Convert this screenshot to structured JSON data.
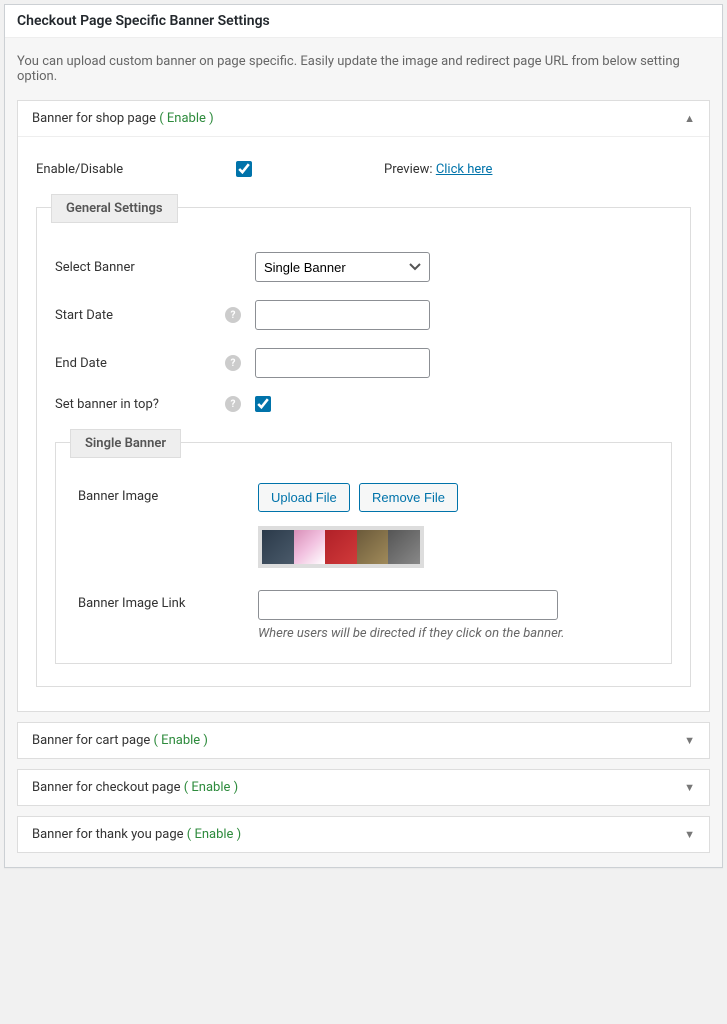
{
  "header": {
    "title": "Checkout Page Specific Banner Settings"
  },
  "description": "You can upload custom banner on page specific. Easily update the image and redirect page URL from below setting option.",
  "accordions": [
    {
      "title": "Banner for shop page",
      "status": "( Enable )",
      "expanded": true
    },
    {
      "title": "Banner for cart page",
      "status": "( Enable )",
      "expanded": false
    },
    {
      "title": "Banner for checkout page",
      "status": "( Enable )",
      "expanded": false
    },
    {
      "title": "Banner for thank you page",
      "status": "( Enable )",
      "expanded": false
    }
  ],
  "panel": {
    "enable_label": "Enable/Disable",
    "enable_checked": true,
    "preview_label": "Preview:",
    "preview_link": "Click here",
    "general_legend": "General Settings",
    "select_banner_label": "Select Banner",
    "select_banner_value": "Single Banner",
    "start_date_label": "Start Date",
    "start_date_value": "",
    "end_date_label": "End Date",
    "end_date_value": "",
    "set_top_label": "Set banner in top?",
    "set_top_checked": true,
    "single_legend": "Single Banner",
    "banner_image_label": "Banner Image",
    "upload_btn": "Upload File",
    "remove_btn": "Remove File",
    "link_label": "Banner Image Link",
    "link_value": "",
    "link_hint": "Where users will be directed if they click on the banner."
  }
}
